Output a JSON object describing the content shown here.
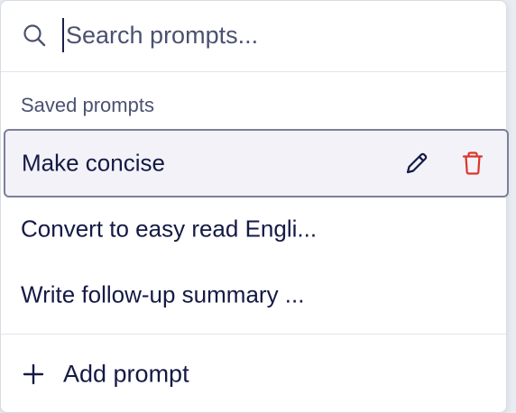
{
  "search": {
    "placeholder": "Search prompts...",
    "value": "",
    "icon": "search-icon"
  },
  "saved": {
    "section_label": "Saved prompts",
    "items": [
      {
        "label": "Make concise",
        "selected": true,
        "actions": [
          "edit-icon",
          "delete-icon"
        ]
      },
      {
        "label": "Convert to easy read Engli...",
        "selected": false
      },
      {
        "label": "Write follow-up summary ...",
        "selected": false
      }
    ]
  },
  "footer": {
    "add_label": "Add prompt",
    "icon": "plus-icon"
  },
  "colors": {
    "text": "#141a45",
    "muted": "#4b5170",
    "selected_bg": "#f2f2f8",
    "selected_border": "#7b7f98",
    "delete": "#d9362b",
    "divider": "#e3e5eb"
  }
}
